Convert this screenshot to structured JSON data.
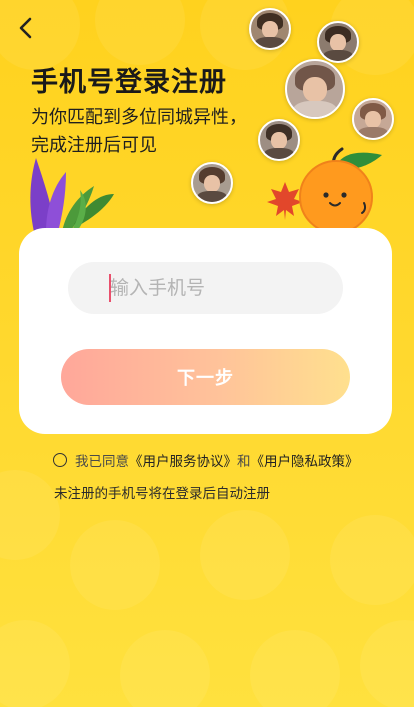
{
  "header": {
    "title": "手机号登录注册",
    "subtitle": "为你匹配到多位同城异性，完成注册后可见"
  },
  "login": {
    "phone_placeholder": "输入手机号",
    "next_label": "下一步"
  },
  "agreement": {
    "prefix": "我已同意",
    "user_agreement": "《用户服务协议》",
    "and": "和",
    "privacy_policy": "《用户隐私政策》",
    "note": "未注册的手机号将在登录后自动注册"
  },
  "colors": {
    "background": "#FFD21E",
    "button_gradient_start": "#FFA79A",
    "button_gradient_end": "#FFE08E",
    "card": "#FFFFFF",
    "input_bg": "#F3F3F3"
  },
  "icons": {
    "back": "chevron-left-icon",
    "radio": "radio-unchecked-icon"
  }
}
